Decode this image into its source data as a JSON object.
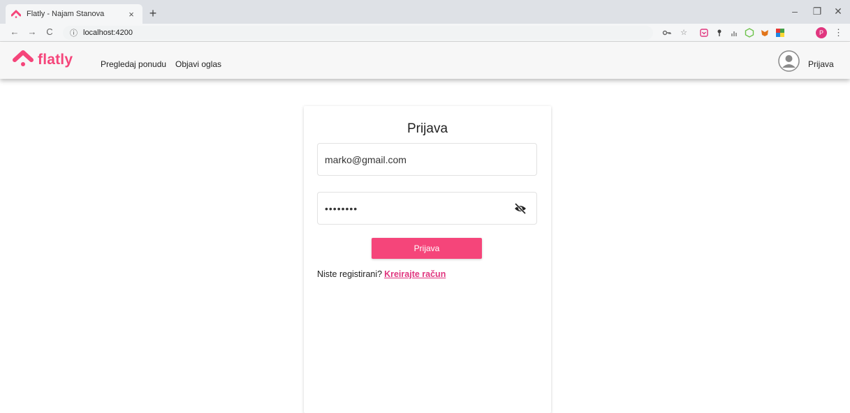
{
  "browser": {
    "tab_title": "Flatly - Najam Stanova",
    "tab_close": "×",
    "new_tab": "+",
    "url": "localhost:4200",
    "info_icon": "ⓘ",
    "profile_initial": "P",
    "window": {
      "minimize": "–",
      "restore": "❐",
      "close": "✕"
    },
    "nav": {
      "back": "←",
      "forward": "→",
      "reload": "C"
    },
    "extensions": [
      "key-icon",
      "star-icon",
      "pocket-icon",
      "pin-icon",
      "bars-icon",
      "nodejs-icon",
      "fox-icon",
      "palette-icon"
    ]
  },
  "app": {
    "brand": "flatly",
    "brand_color": "#f5457a",
    "nav": [
      {
        "label": "Pregledaj ponudu"
      },
      {
        "label": "Objavi oglas"
      }
    ],
    "login_label": "Prijava"
  },
  "login_form": {
    "title": "Prijava",
    "email_value": "marko@gmail.com",
    "password_value": "••••••••",
    "submit_label": "Prijava",
    "register_prompt": "Niste registirani?",
    "register_link": "Kreirajte račun"
  }
}
